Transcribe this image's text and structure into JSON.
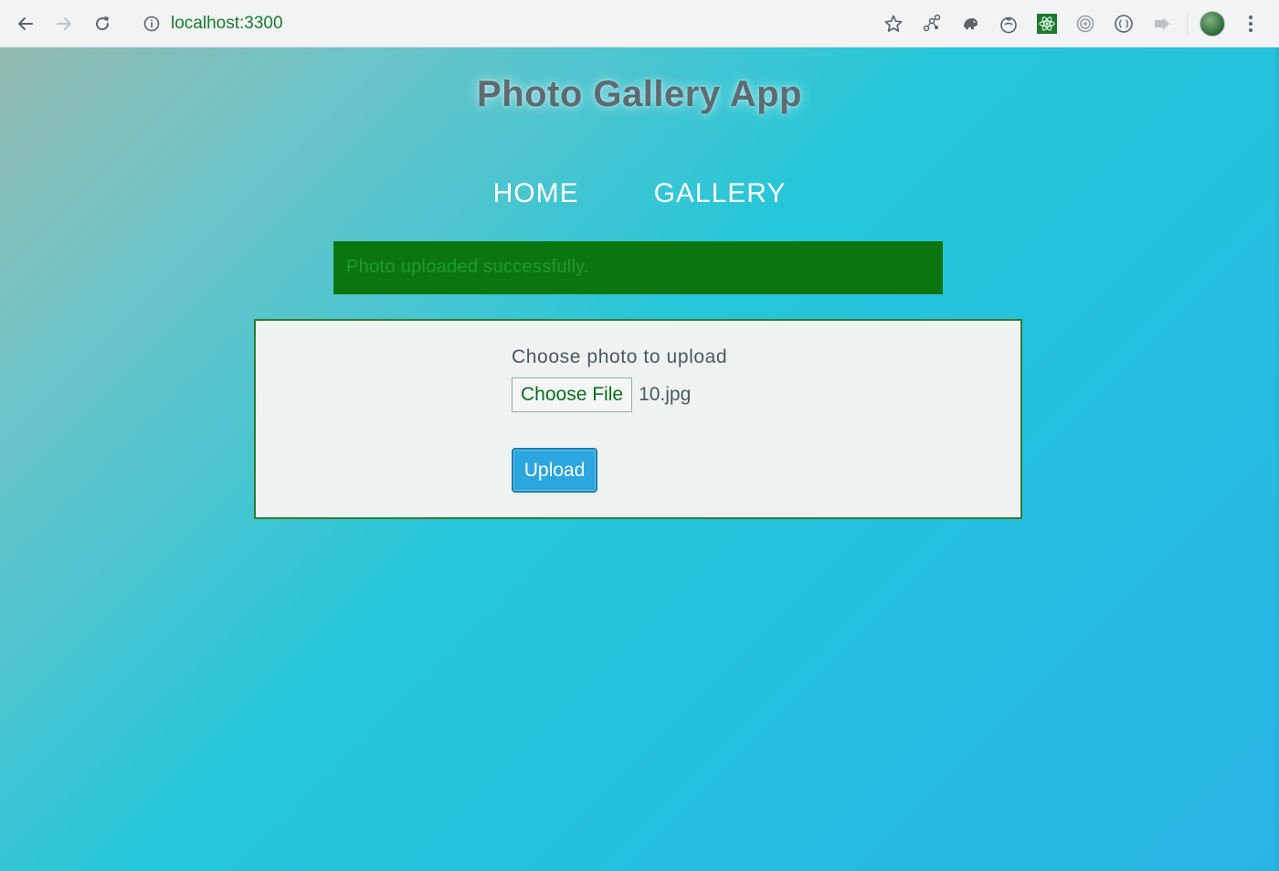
{
  "browser": {
    "url": "localhost:3300",
    "icons": {
      "back": "back-arrow-icon",
      "forward": "forward-arrow-icon",
      "reload": "reload-icon",
      "info": "info-icon",
      "bookmark": "star-icon",
      "menu": "three-dots-icon"
    },
    "extensions": [
      "graph-extension-icon",
      "elephant-extension-icon",
      "tomato-timer-icon",
      "react-devtools-icon",
      "target-extension-icon",
      "code-braces-icon",
      "forward-shape-icon"
    ]
  },
  "page": {
    "title": "Photo Gallery App",
    "nav": [
      {
        "label": "HOME"
      },
      {
        "label": "GALLERY"
      }
    ],
    "alert": {
      "message": "Photo uploaded successfully.",
      "color": "#0b760f"
    },
    "upload": {
      "label": "Choose photo to upload",
      "file_button": "Choose File",
      "file_name": "10.jpg",
      "submit": "Upload"
    }
  },
  "colors": {
    "accent": "#2ba6de",
    "success": "#0b760f",
    "url_text": "#1a7a2e"
  }
}
